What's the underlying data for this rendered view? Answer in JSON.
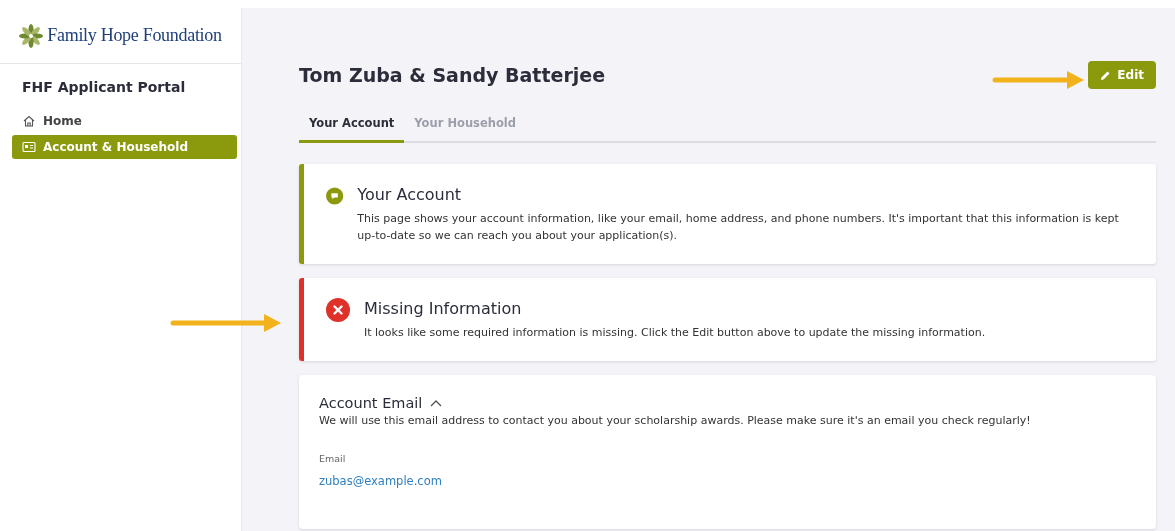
{
  "sidebar": {
    "logo_text": "Family Hope Foundation",
    "title": "FHF Applicant Portal",
    "items": [
      {
        "label": "Home",
        "kind": "home",
        "selected": false
      },
      {
        "label": "Account & Household",
        "kind": "card",
        "selected": true
      }
    ]
  },
  "header": {
    "title": "Tom Zuba & Sandy Batterjee",
    "edit_button": "Edit"
  },
  "tabs": [
    {
      "label": "Your Account",
      "selected": true
    },
    {
      "label": "Your Household",
      "selected": false
    }
  ],
  "alerts": [
    {
      "kind": "info",
      "title": "Your Account",
      "text": "This page shows your account information, like your email, home address, and phone numbers. It's important that this information is kept up-to-date so we can reach you about your application(s)."
    },
    {
      "kind": "error",
      "title": "Missing Information",
      "text": "It looks like some required information is missing. Click the Edit button above to update the missing information."
    }
  ],
  "section": {
    "title": "Account Email",
    "expanded": true,
    "description": "We will use this email address to contact you about your scholarship awards. Please make sure it's an email you check regularly!",
    "field_label": "Email",
    "field_value": "zubas@example.com"
  }
}
